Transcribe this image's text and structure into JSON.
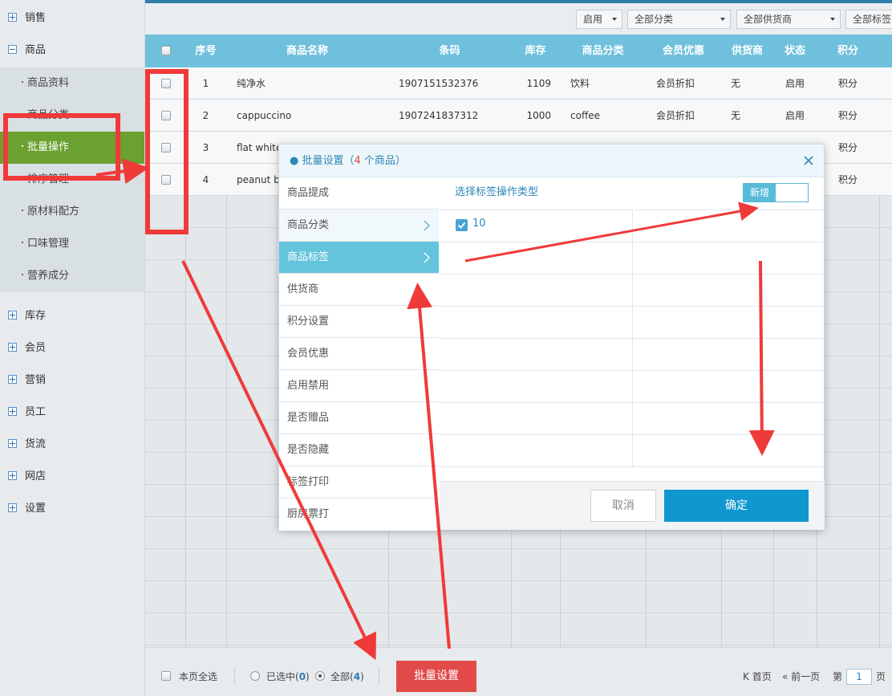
{
  "sidebar": {
    "groups": [
      {
        "label": "销售",
        "expanded": false
      },
      {
        "label": "商品",
        "expanded": true
      },
      {
        "label": "库存",
        "expanded": false
      },
      {
        "label": "会员",
        "expanded": false
      },
      {
        "label": "营销",
        "expanded": false
      },
      {
        "label": "员工",
        "expanded": false
      },
      {
        "label": "货流",
        "expanded": false
      },
      {
        "label": "网店",
        "expanded": false
      },
      {
        "label": "设置",
        "expanded": false
      }
    ],
    "sub_items": [
      {
        "label": "商品资料",
        "active": false
      },
      {
        "label": "商品分类",
        "active": false
      },
      {
        "label": "批量操作",
        "active": true
      },
      {
        "label": "排序管理",
        "active": false
      },
      {
        "label": "原材料配方",
        "active": false
      },
      {
        "label": "口味管理",
        "active": false
      },
      {
        "label": "营养成分",
        "active": false
      }
    ]
  },
  "filters": [
    {
      "label": "启用"
    },
    {
      "label": "全部分类"
    },
    {
      "label": "全部供货商"
    },
    {
      "label": "全部标签"
    }
  ],
  "table": {
    "columns": [
      "序号",
      "商品名称",
      "条码",
      "库存",
      "商品分类",
      "会员优惠",
      "供货商",
      "状态",
      "积分"
    ],
    "rows": [
      {
        "no": "1",
        "name": "纯净水",
        "barcode": "1907151532376",
        "stock": "1109",
        "category": "饮料",
        "discount": "会员折扣",
        "supplier": "无",
        "status": "启用",
        "points": "积分"
      },
      {
        "no": "2",
        "name": "cappuccino",
        "barcode": "1907241837312",
        "stock": "1000",
        "category": "coffee",
        "discount": "会员折扣",
        "supplier": "无",
        "status": "启用",
        "points": "积分"
      },
      {
        "no": "3",
        "name": "flat white",
        "barcode": "",
        "stock": "",
        "category": "",
        "discount": "",
        "supplier": "",
        "status": "",
        "points": "积分"
      },
      {
        "no": "4",
        "name": "peanut bu",
        "barcode": "",
        "stock": "",
        "category": "",
        "discount": "",
        "supplier": "",
        "status": "",
        "points": "积分"
      }
    ]
  },
  "bottom": {
    "select_page": "本页全选",
    "selected_label": "已选中(",
    "selected_count": "0",
    "selected_close": ")",
    "all_label": "全部(",
    "all_count": "4",
    "all_close": ")",
    "batch_button": "批量设置",
    "first_page": "首页",
    "prev_page": "前一页",
    "page_prefix": "第",
    "page_value": "1",
    "page_suffix": "页"
  },
  "modal": {
    "title_prefix": "批量设置（",
    "title_count": "4",
    "title_suffix": " 个商品）",
    "nav": [
      {
        "label": "商品提成",
        "state": "normal"
      },
      {
        "label": "商品分类",
        "state": "hover"
      },
      {
        "label": "商品标签",
        "state": "selected"
      },
      {
        "label": "供货商",
        "state": "normal"
      },
      {
        "label": "积分设置",
        "state": "normal"
      },
      {
        "label": "会员优惠",
        "state": "normal"
      },
      {
        "label": "启用禁用",
        "state": "normal"
      },
      {
        "label": "是否赠品",
        "state": "normal"
      },
      {
        "label": "是否隐藏",
        "state": "normal"
      },
      {
        "label": "标签打印",
        "state": "normal"
      },
      {
        "label": "厨房票打",
        "state": "normal"
      }
    ],
    "section_label": "选择标签操作类型",
    "toggle_label": "新增",
    "tag_label": "10",
    "tag_checked": true,
    "cancel": "取消",
    "confirm": "确定"
  },
  "colors": {
    "header": "#6fc0dc",
    "active_sidebar": "#6aa131",
    "batch_button": "#e24a4a",
    "confirm": "#0f97cf",
    "annotation": "#f03a3a"
  }
}
